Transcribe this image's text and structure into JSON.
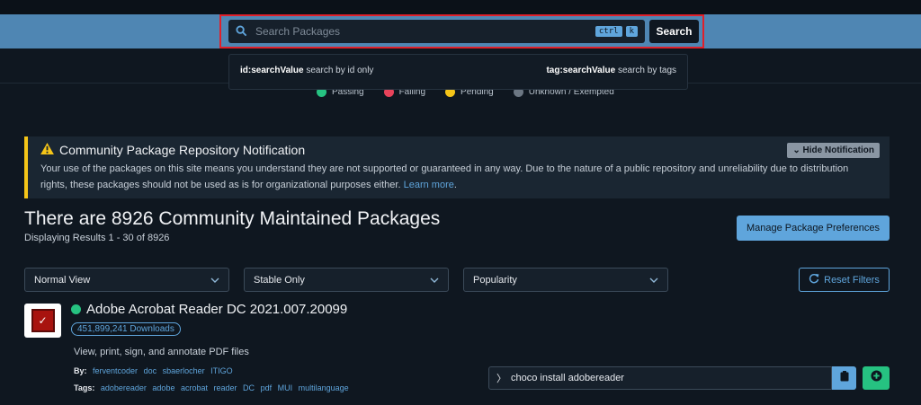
{
  "search": {
    "placeholder": "Search Packages",
    "kbd1": "ctrl",
    "kbd2": "k",
    "button_label": "Search"
  },
  "search_hint": {
    "left_key": "id:searchValue",
    "left_text": " search by id only",
    "right_key": "tag:searchValue",
    "right_text": " search by tags"
  },
  "legend": [
    {
      "label": "Passing",
      "color": "#26c281"
    },
    {
      "label": "Failing",
      "color": "#e8435a"
    },
    {
      "label": "Pending",
      "color": "#f5c518"
    },
    {
      "label": "Unknown / Exempted",
      "color": "#6c7783"
    }
  ],
  "notice": {
    "title": "Community Package Repository Notification",
    "hide_label": "Hide Notification",
    "body": "Your use of the packages on this site means you understand they are not supported or guaranteed in any way. Due to the nature of a public repository and unreliability due to distribution rights, these packages should not be used as is for organizational purposes either.",
    "link": "Learn more",
    "accent": "#f5c518"
  },
  "listing": {
    "title": "There are 8926 Community Maintained Packages",
    "subtitle": "Displaying Results 1 - 30 of 8926",
    "pref_button": "Manage Package Preferences"
  },
  "filters": {
    "view": "Normal View",
    "stability": "Stable Only",
    "sort": "Popularity",
    "reset_label": "Reset Filters"
  },
  "package": {
    "name": "Adobe Acrobat Reader DC 2021.007.20099",
    "downloads": "451,899,241 Downloads",
    "description": "View, print, sign, and annotate PDF files",
    "by_label": "By:",
    "authors": [
      "ferventcoder",
      "doc",
      "sbaerlocher",
      "ITIGO"
    ],
    "tags_label": "Tags:",
    "tags": [
      "adobereader",
      "adobe",
      "acrobat",
      "reader",
      "DC",
      "pdf",
      "MUI",
      "multilanguage"
    ],
    "install_cmd": "choco install adobereader"
  }
}
